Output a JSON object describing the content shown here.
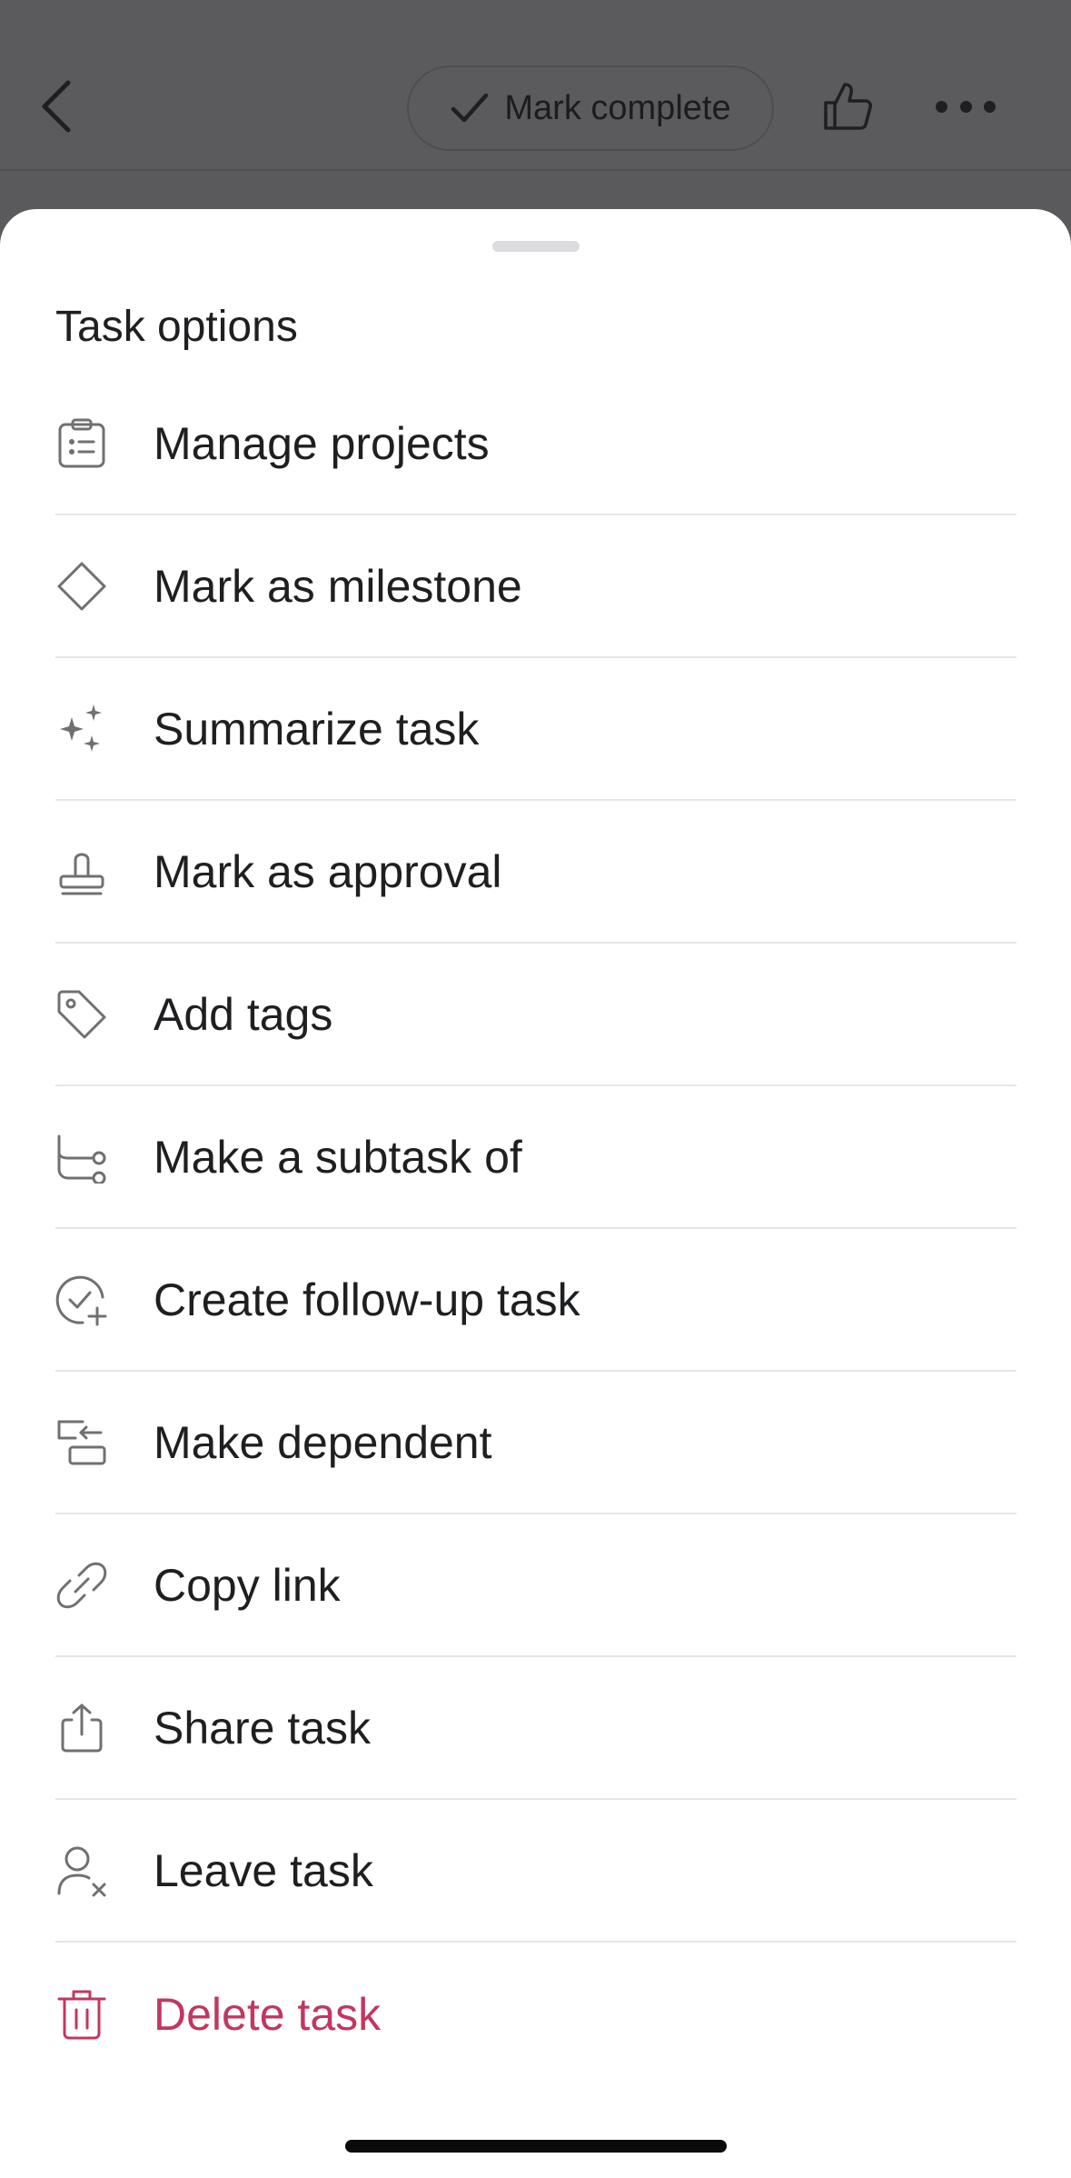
{
  "header": {
    "mark_complete_label": "Mark complete",
    "icons": [
      "chevron-left-icon",
      "check-icon",
      "thumbs-up-icon",
      "more-icon"
    ]
  },
  "sheet": {
    "title": "Task options",
    "items": [
      {
        "label": "Manage projects",
        "icon": "clipboard-list-icon"
      },
      {
        "label": "Mark as milestone",
        "icon": "diamond-icon"
      },
      {
        "label": "Summarize task",
        "icon": "sparkles-icon"
      },
      {
        "label": "Mark as approval",
        "icon": "stamp-icon"
      },
      {
        "label": "Add tags",
        "icon": "tag-icon"
      },
      {
        "label": "Make a subtask of",
        "icon": "subtask-icon"
      },
      {
        "label": "Create follow-up task",
        "icon": "check-circle-plus-icon"
      },
      {
        "label": "Make dependent",
        "icon": "dependency-icon"
      },
      {
        "label": "Copy link",
        "icon": "link-icon"
      },
      {
        "label": "Share task",
        "icon": "share-icon"
      },
      {
        "label": "Leave task",
        "icon": "user-remove-icon"
      },
      {
        "label": "Delete task",
        "icon": "trash-icon"
      }
    ]
  },
  "colors": {
    "danger": "#c2375e",
    "text": "#1e1f21",
    "icon": "#6f7072",
    "overlay": "#5a5a5c"
  }
}
